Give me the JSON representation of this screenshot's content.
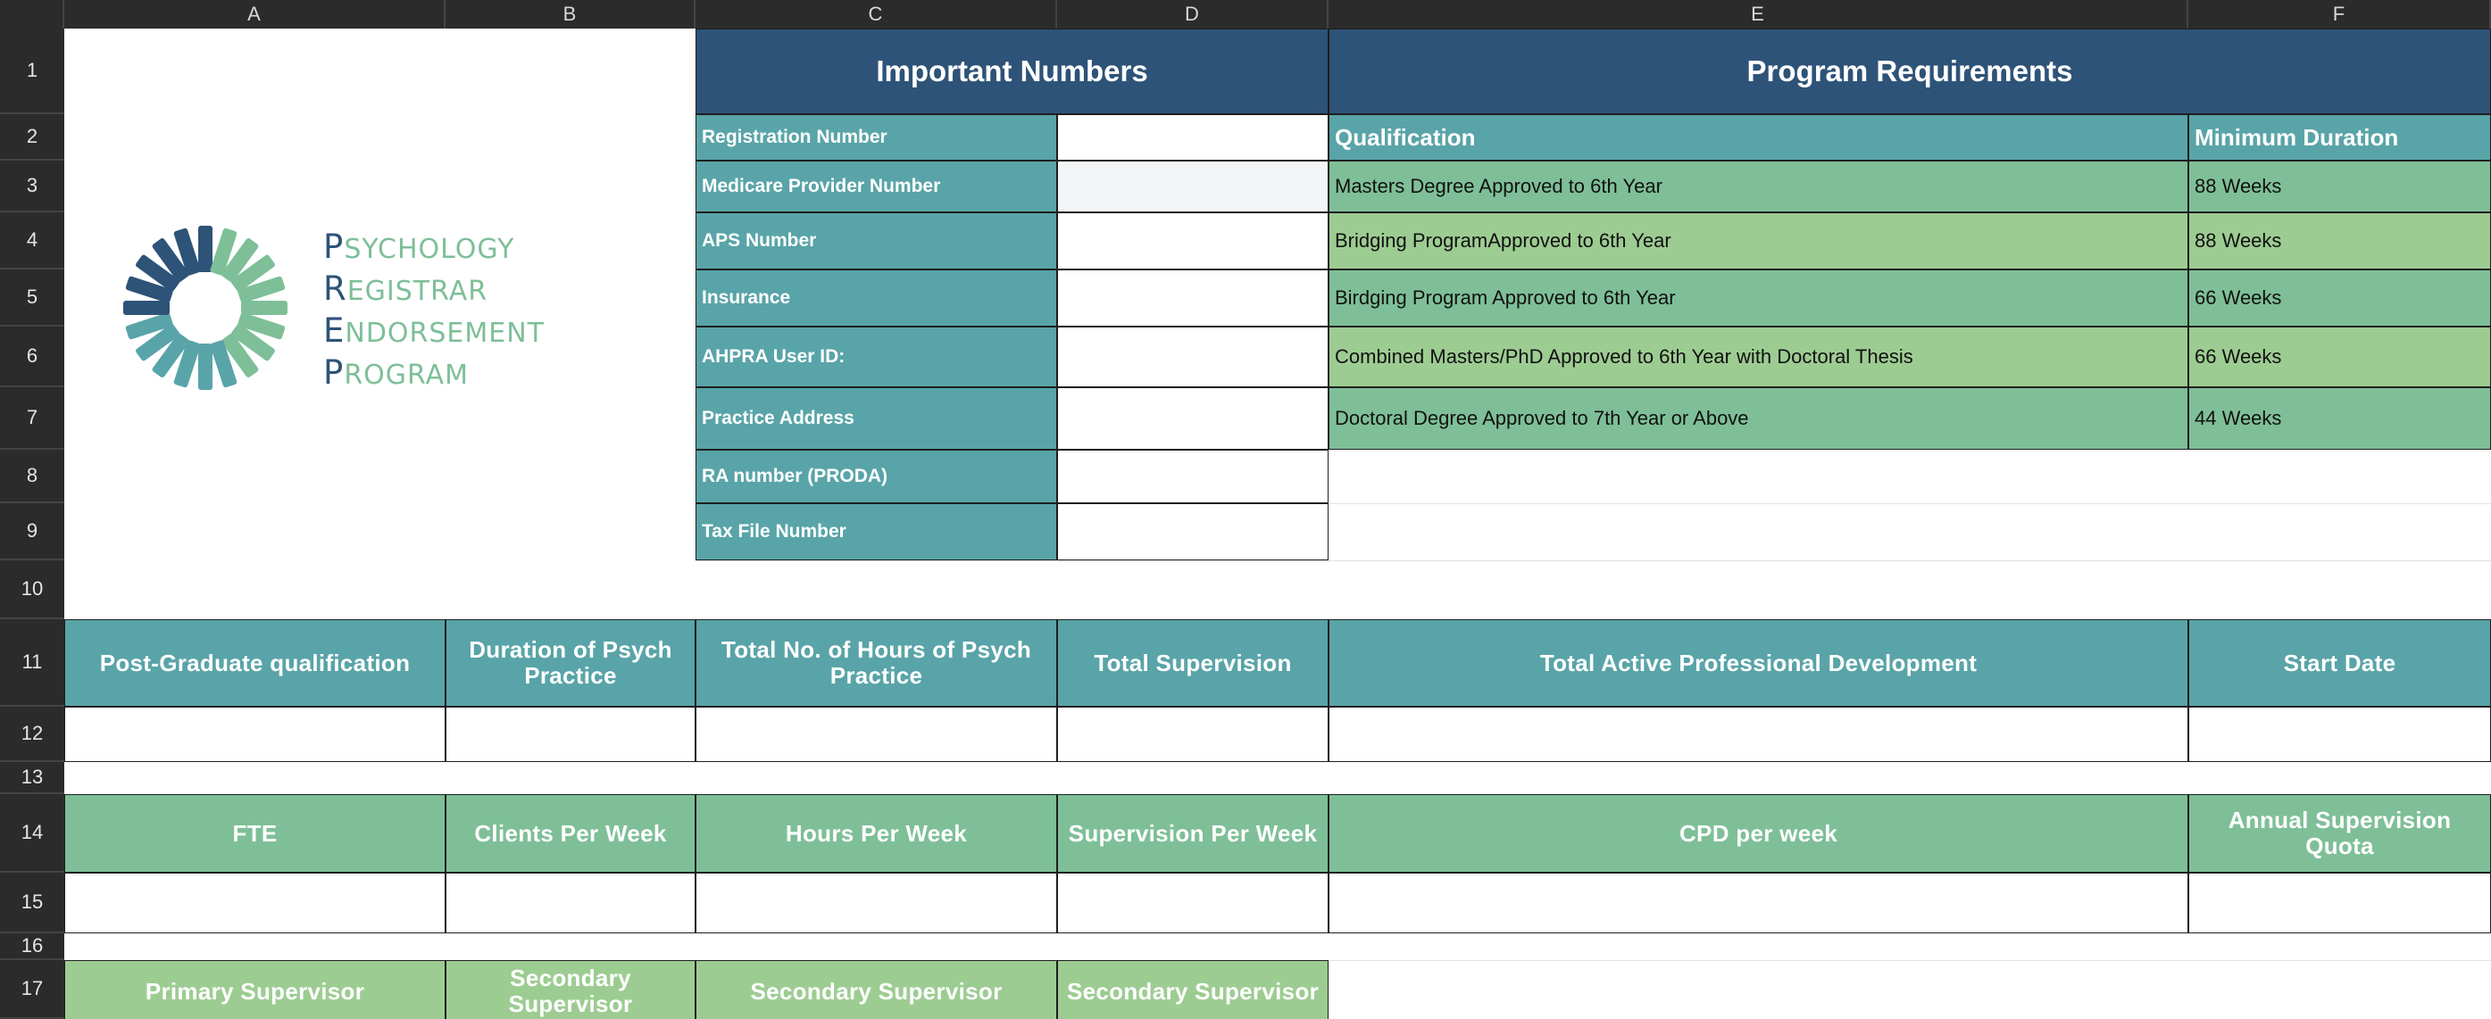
{
  "columns": [
    "A",
    "B",
    "C",
    "D",
    "E",
    "F"
  ],
  "rows": [
    "1",
    "2",
    "3",
    "4",
    "5",
    "6",
    "7",
    "8",
    "9",
    "10",
    "11",
    "12",
    "13",
    "14",
    "15",
    "16",
    "17"
  ],
  "logo": {
    "lines": [
      {
        "initial": "P",
        "rest": "SYCHOLOGY"
      },
      {
        "initial": "R",
        "rest": "EGISTRAR"
      },
      {
        "initial": "E",
        "rest": "NDORSEMENT"
      },
      {
        "initial": "P",
        "rest": "ROGRAM"
      }
    ],
    "colors": {
      "dark": "#2e5378",
      "mid": "#59a4a8",
      "light": "#7ebf98"
    }
  },
  "important_numbers": {
    "title": "Important Numbers",
    "fields": [
      {
        "label": "Registration Number",
        "value": ""
      },
      {
        "label": "Medicare Provider Number",
        "value": ""
      },
      {
        "label": "APS Number",
        "value": ""
      },
      {
        "label": "Insurance",
        "value": ""
      },
      {
        "label": "AHPRA User ID:",
        "value": ""
      },
      {
        "label": "Practice Address",
        "value": ""
      },
      {
        "label": "RA number (PRODA)",
        "value": ""
      },
      {
        "label": "Tax File Number",
        "value": ""
      }
    ]
  },
  "program_requirements": {
    "title": "Program Requirements",
    "headers": {
      "qualification": "Qualification",
      "duration": "Minimum Duration"
    },
    "rows": [
      {
        "qualification": "Masters Degree Approved to 6th Year",
        "duration": "88 Weeks"
      },
      {
        "qualification": "Bridging ProgramApproved to 6th Year",
        "duration": "88 Weeks"
      },
      {
        "qualification": "Birdging Program Approved to 6th Year",
        "duration": "66 Weeks"
      },
      {
        "qualification": "Combined Masters/PhD Approved to 6th Year with Doctoral Thesis",
        "duration": "66 Weeks"
      },
      {
        "qualification": "Doctoral Degree Approved to 7th Year or Above",
        "duration": "44 Weeks"
      }
    ]
  },
  "summary_headers": [
    "Post-Graduate qualification",
    "Duration of Psych Practice",
    "Total No. of Hours of Psych Practice",
    "Total Supervision",
    "Total Active Professional Development",
    "Start Date"
  ],
  "weekly_headers": [
    "FTE",
    "Clients Per Week",
    "Hours Per Week",
    "Supervision Per Week",
    "CPD per week",
    "Annual Supervision Quota"
  ],
  "supervisor_headers": [
    "Primary Supervisor",
    "Secondary Supervisor",
    "Secondary Supervisor",
    "Secondary Supervisor"
  ],
  "colors": {
    "navy": "#2e5378",
    "teal": "#59a4a8",
    "green": "#7ebf98",
    "light_green": "#9dcc92"
  }
}
